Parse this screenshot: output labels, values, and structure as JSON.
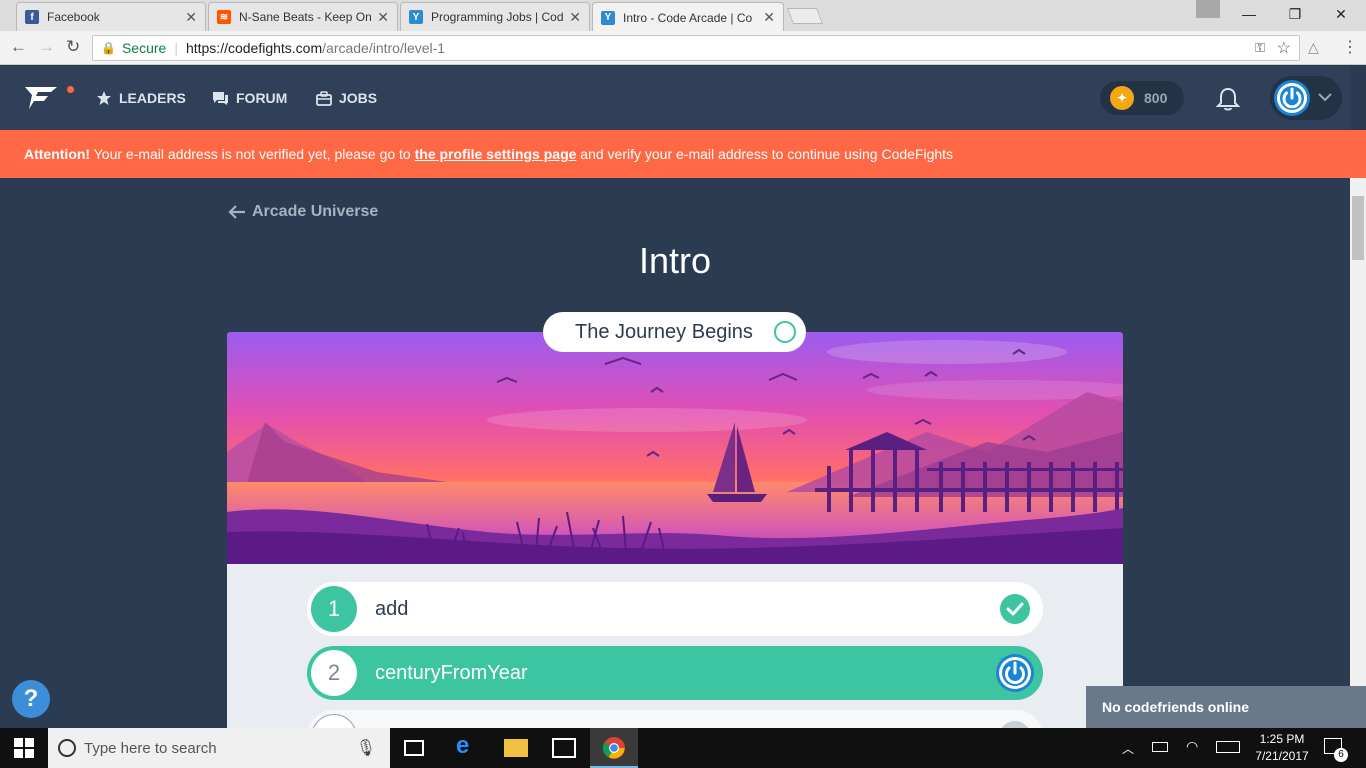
{
  "browser": {
    "tabs": [
      {
        "title": "Facebook",
        "favicon_color": "#3b5998",
        "favicon_glyph": "f"
      },
      {
        "title": "N-Sane Beats - Keep On",
        "favicon_color": "#ff5500",
        "favicon_glyph": "≋"
      },
      {
        "title": "Programming Jobs | Cod",
        "favicon_color": "#2e8bd1",
        "favicon_glyph": "Y"
      },
      {
        "title": "Intro - Code Arcade | Co",
        "favicon_color": "#2e8bd1",
        "favicon_glyph": "Y"
      }
    ],
    "url_secure_label": "Secure",
    "url_host": "https://codefights.com",
    "url_path": "/arcade/intro/level-1"
  },
  "header": {
    "nav": [
      {
        "label": "LEADERS",
        "icon": "star-icon"
      },
      {
        "label": "FORUM",
        "icon": "forum-icon"
      },
      {
        "label": "JOBS",
        "icon": "briefcase-icon"
      }
    ],
    "coins": "800"
  },
  "alert": {
    "prefix": "Attention!",
    "text_before": " Your e-mail address is not verified yet, please go to ",
    "link": "the profile settings page",
    "text_after": " and verify your e-mail address to continue using CodeFights"
  },
  "main": {
    "back_label": "Arcade Universe",
    "title": "Intro",
    "chapter": "The Journey Begins",
    "tasks": [
      {
        "num": "1",
        "name": "add"
      },
      {
        "num": "2",
        "name": "centuryFromYear"
      }
    ]
  },
  "chat": {
    "label": "No codefriends online"
  },
  "taskbar": {
    "search_placeholder": "Type here to search",
    "time": "1:25 PM",
    "date": "7/21/2017",
    "notification_count": "6"
  },
  "colors": {
    "accent": "#3cc5a0",
    "alert": "#ff6845",
    "header": "#2f4058",
    "background": "#2b3b52"
  }
}
